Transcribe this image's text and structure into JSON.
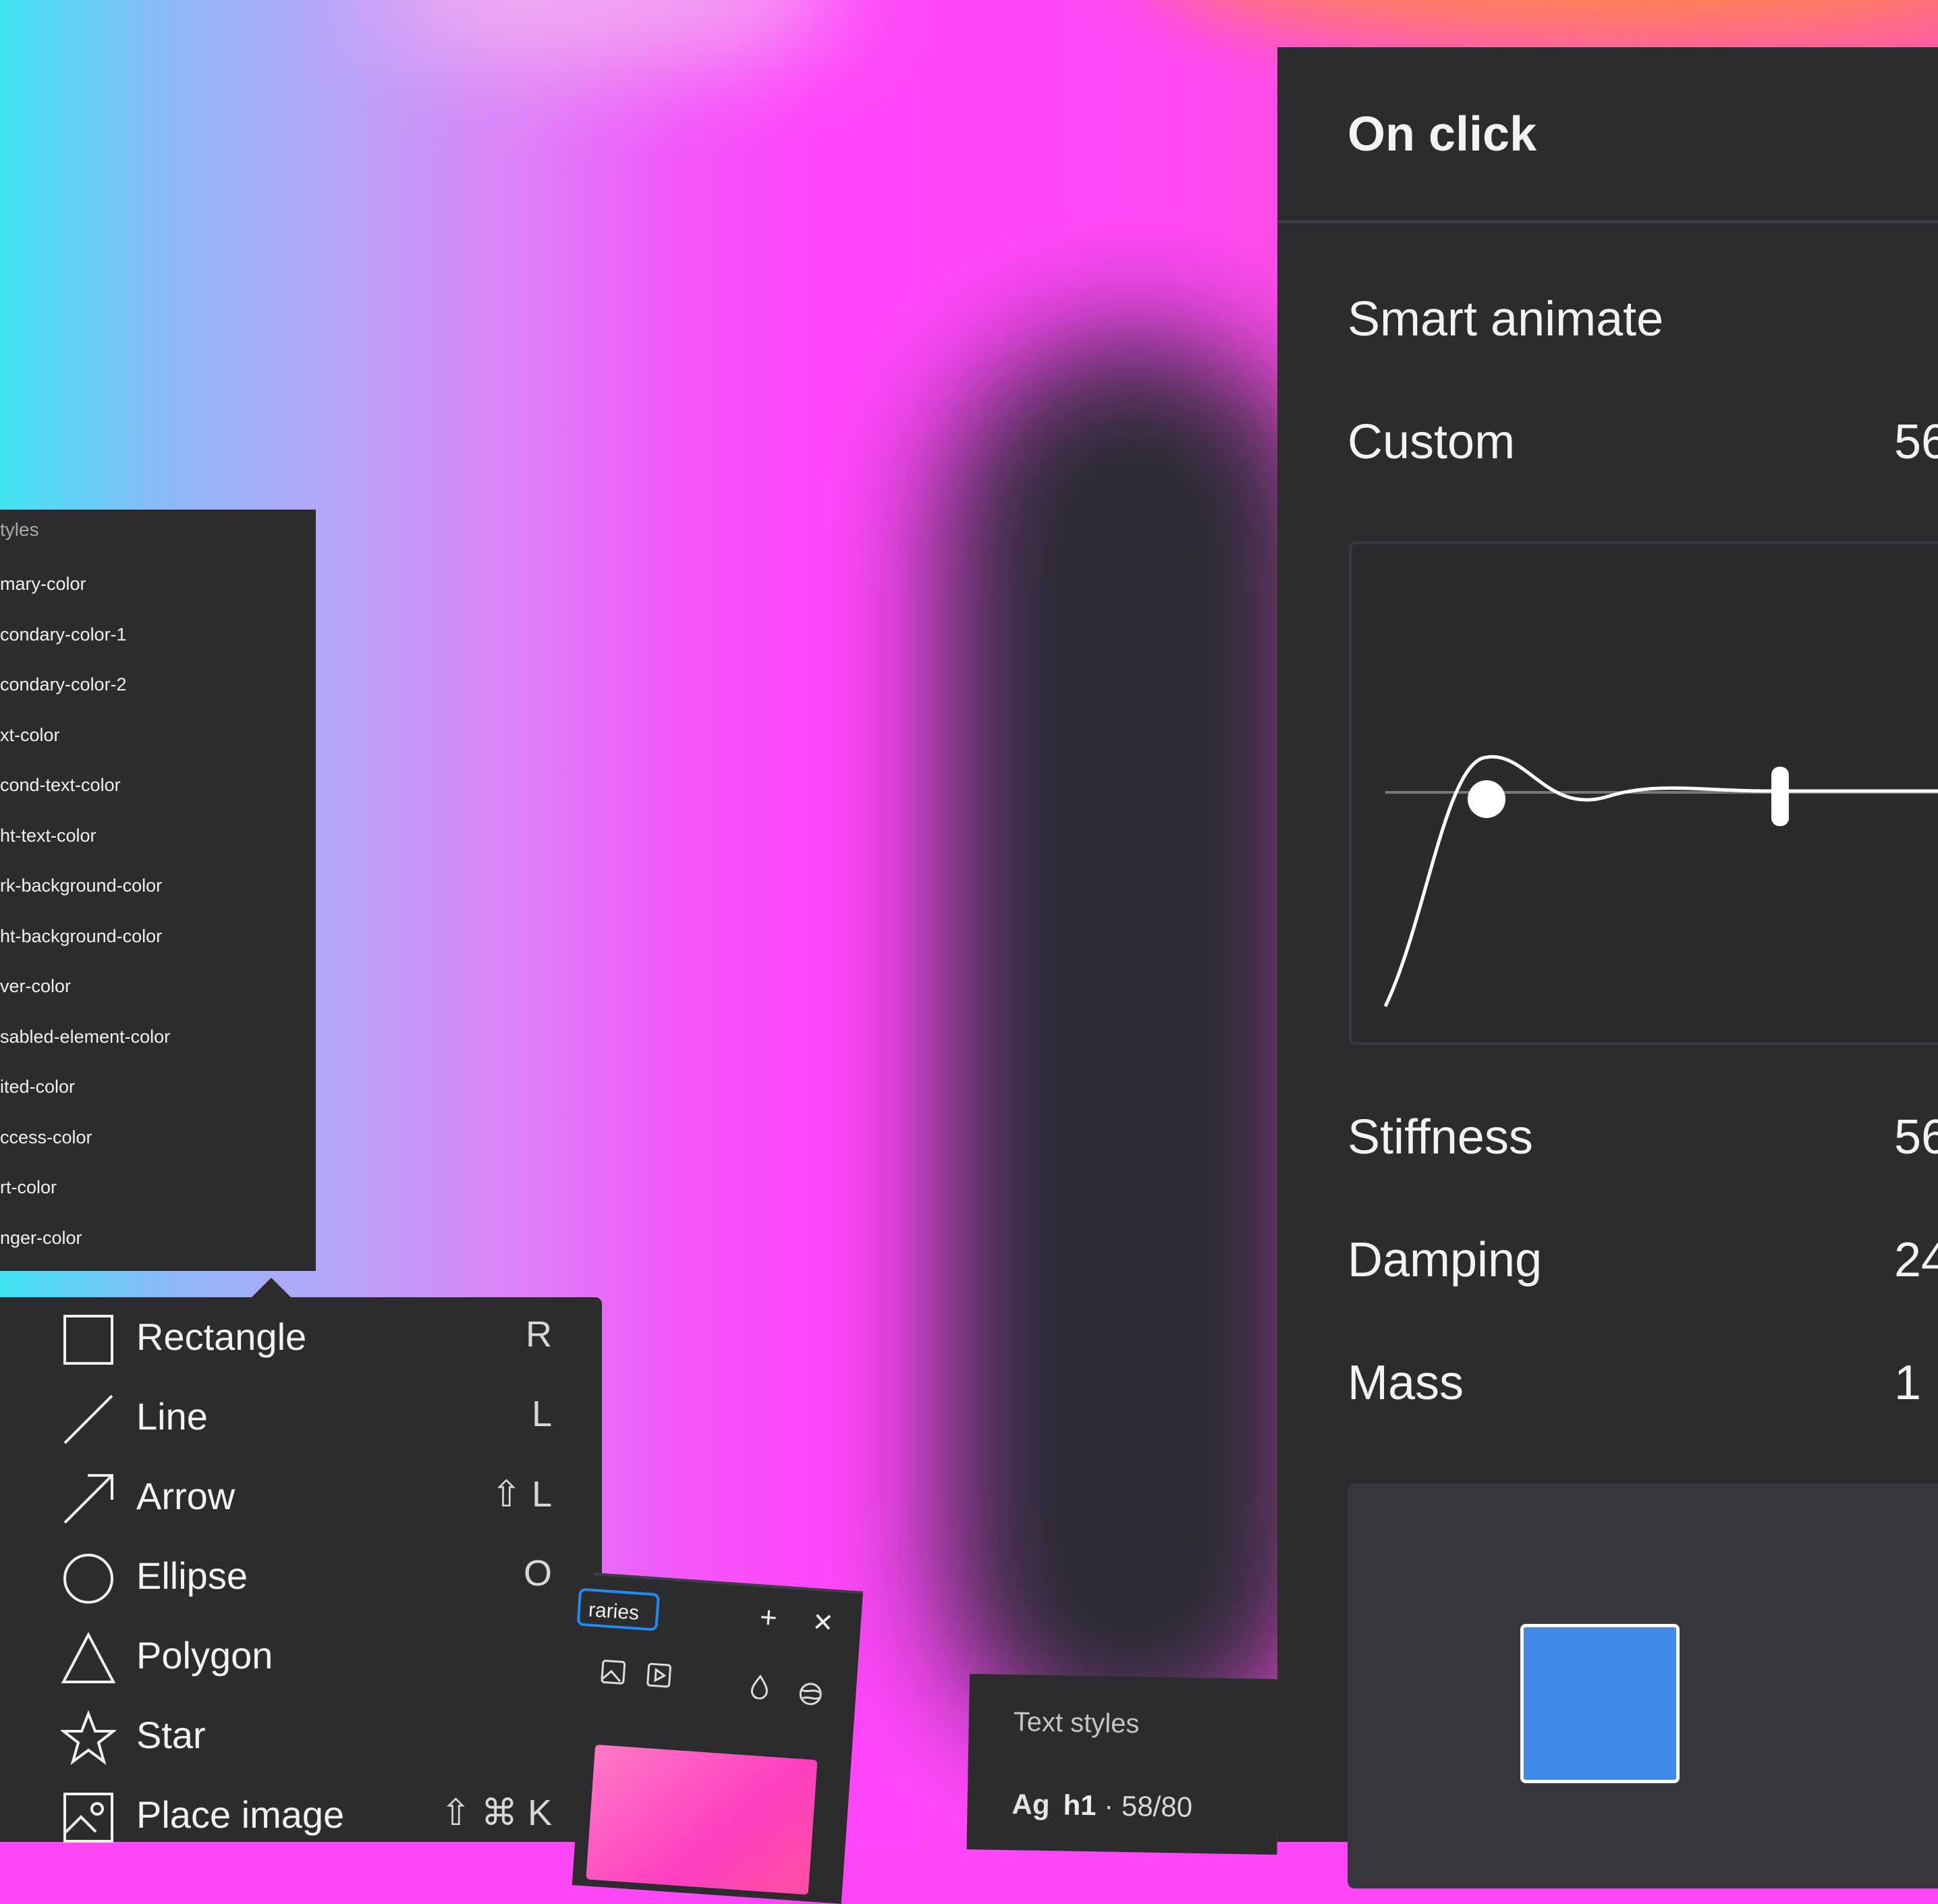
{
  "prototype_panel": {
    "trigger": "On click",
    "animation": "Smart animate",
    "curve_preset": "Custom",
    "curve_preset_value": "56",
    "stiffness_label": "Stiffness",
    "stiffness_value": "56",
    "damping_label": "Damping",
    "damping_value": "24",
    "mass_label": "Mass",
    "mass_value": "1",
    "preview_color": "#4089e6"
  },
  "styles_list": {
    "title": "tyles",
    "items": [
      "mary-color",
      "condary-color-1",
      "condary-color-2",
      "xt-color",
      "cond-text-color",
      "ht-text-color",
      "rk-background-color",
      "ht-background-color",
      "ver-color",
      "sabled-element-color",
      "ited-color",
      "ccess-color",
      "rt-color",
      "nger-color"
    ]
  },
  "shape_menu": {
    "items": [
      {
        "label": "Rectangle",
        "shortcut": "R",
        "icon": "rectangle-icon"
      },
      {
        "label": "Line",
        "shortcut": "L",
        "icon": "line-icon"
      },
      {
        "label": "Arrow",
        "shortcut": "⇧ L",
        "icon": "arrow-icon"
      },
      {
        "label": "Ellipse",
        "shortcut": "O",
        "icon": "ellipse-icon"
      },
      {
        "label": "Polygon",
        "shortcut": "",
        "icon": "polygon-icon"
      },
      {
        "label": "Star",
        "shortcut": "",
        "icon": "star-icon"
      },
      {
        "label": "Place image",
        "shortcut": "⇧ ⌘ K",
        "icon": "image-icon"
      }
    ]
  },
  "libraries_panel": {
    "tab_label": "raries",
    "add_label": "+",
    "close_label": "✕"
  },
  "text_styles_panel": {
    "title": "Text styles",
    "sample": "Ag",
    "style_name": "h1",
    "style_spec": " · 58/80"
  }
}
